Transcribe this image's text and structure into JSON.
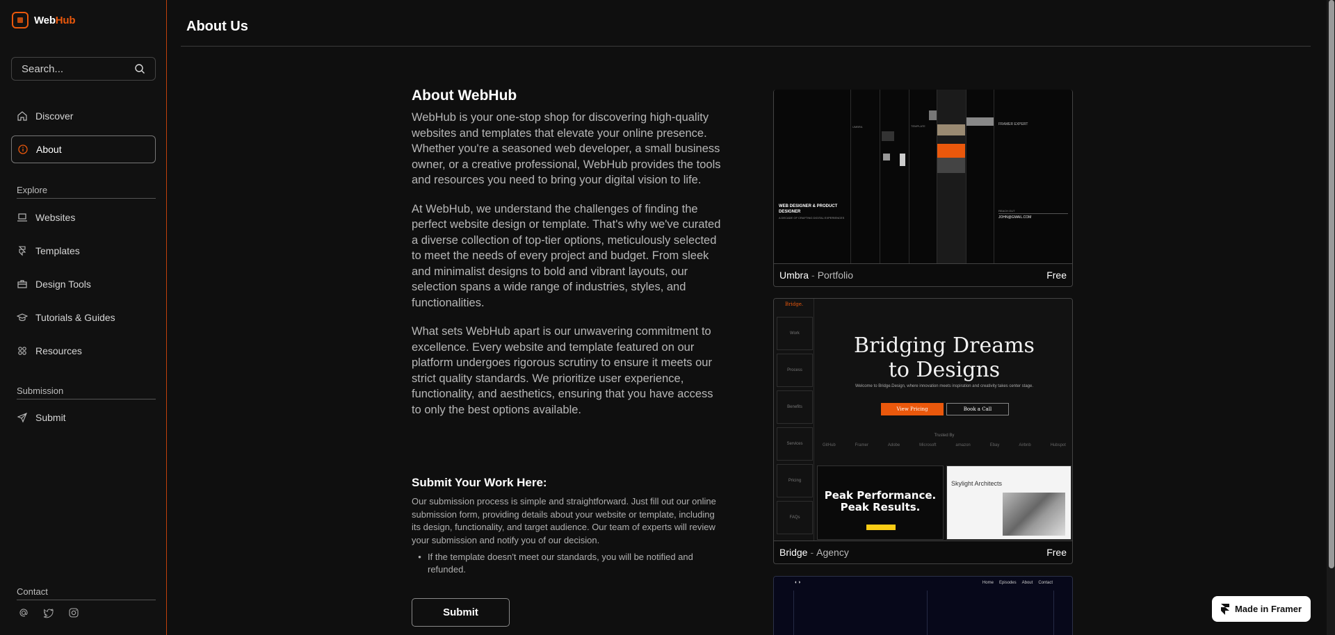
{
  "brand": {
    "name_part1": "Web",
    "name_part2": "Hub",
    "accent": "#ea580c"
  },
  "search": {
    "placeholder": "Search..."
  },
  "nav": {
    "primary": [
      {
        "label": "Discover",
        "icon": "home-icon"
      },
      {
        "label": "About",
        "icon": "info-icon",
        "active": true
      }
    ],
    "explore_label": "Explore",
    "explore": [
      {
        "label": "Websites",
        "icon": "laptop-icon"
      },
      {
        "label": "Templates",
        "icon": "framer-icon"
      },
      {
        "label": "Design Tools",
        "icon": "briefcase-icon"
      },
      {
        "label": "Tutorials & Guides",
        "icon": "graduation-cap-icon"
      },
      {
        "label": "Resources",
        "icon": "grid-icon"
      }
    ],
    "submission_label": "Submission",
    "submission": [
      {
        "label": "Submit",
        "icon": "send-icon"
      }
    ],
    "contact_label": "Contact",
    "social": [
      "at-sign-icon",
      "twitter-icon",
      "instagram-icon"
    ]
  },
  "header": {
    "title": "About Us"
  },
  "about": {
    "heading": "About WebHub",
    "paragraphs": [
      "WebHub is your one-stop shop for discovering high-quality websites and templates that elevate your online presence. Whether you're a seasoned web developer, a small business owner, or a creative professional, WebHub provides the tools and resources you need to bring your digital vision to life.",
      "At WebHub, we understand the challenges of finding the perfect website design or template. That's why we've curated a diverse collection of top-tier options, meticulously selected to meet the needs of every project and budget. From sleek and minimalist designs to bold and vibrant layouts, our selection spans a wide range of industries, styles, and functionalities.",
      "What sets WebHub apart is our unwavering commitment to excellence. Every website and template featured on our platform undergoes rigorous scrutiny to ensure it meets our strict quality standards. We prioritize user experience, functionality, and aesthetics, ensuring that you have access to only the best options available."
    ]
  },
  "submit_section": {
    "heading": "Submit Your Work Here:",
    "body": "Our submission process is simple and straightforward. Just fill out our online submission form, providing details about your website or template, including its design, functionality, and target audience. Our team of experts will review your submission and notify you of our decision.",
    "bullet": "If the template doesn't meet our standards, you will be notified and refunded.",
    "button": "Submit"
  },
  "cards": [
    {
      "name": "Umbra",
      "sep": "-",
      "category": "Portfolio",
      "price": "Free",
      "preview": {
        "role": "WEB DESIGNER & PRODUCT DESIGNER",
        "tagline": "A DECADE OF CRAFTING DIGITAL EXPERIENCES",
        "email": "JOHN@GMAIL.COM",
        "reach": "REACH OUT",
        "framer": "FRAMER EXPERT",
        "umbra": "UMBRA",
        "template": "TEMPLATE"
      }
    },
    {
      "name": "Bridge",
      "sep": "-",
      "category": "Agency",
      "price": "Free",
      "preview": {
        "logo": "Bridge.",
        "side_items": [
          "Work",
          "Process",
          "Benefits",
          "Services",
          "Pricing",
          "FAQs"
        ],
        "headline_1": "Bridging Dreams",
        "headline_2": "to Designs",
        "sub": "Welcome to Bridge.Design, where innovation meets inspiration and creativity takes center stage.",
        "btn1": "View Pricing",
        "btn2": "Book a Call",
        "trusted": "Trusted By",
        "logos": [
          "GitHub",
          "Framer",
          "Adobe",
          "Microsoft",
          "amazon",
          "Ebay",
          "Airbnb",
          "Hubspot"
        ],
        "tile1_l1": "Peak Performance.",
        "tile1_l2": "Peak Results.",
        "tile2": "Skylight Architects"
      }
    },
    {
      "preview": {
        "nav": [
          "Home",
          "Episodes",
          "About",
          "Contact"
        ]
      }
    }
  ],
  "framer_badge": "Made in Framer"
}
